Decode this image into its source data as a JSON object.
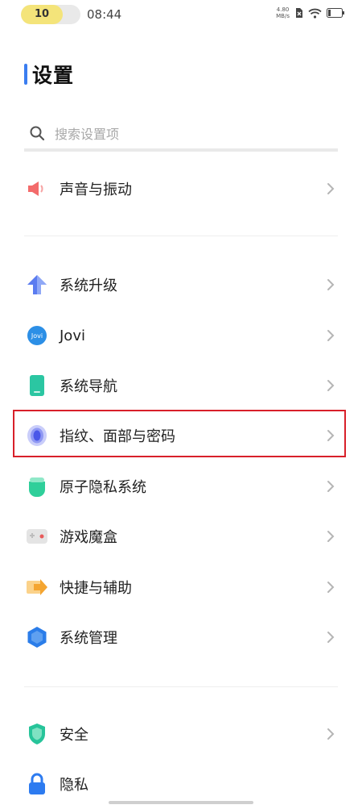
{
  "status_bar": {
    "battery": "10",
    "time": "08:44",
    "net_speed_value": "4.80",
    "net_speed_unit": "MB/s"
  },
  "page": {
    "title": "设置"
  },
  "search": {
    "placeholder": "搜索设置项"
  },
  "items": [
    {
      "label": "声音与振动",
      "icon": "speaker-icon",
      "color": "#f36b6b"
    },
    {
      "label": "系统升级",
      "icon": "upgrade-arrow-icon",
      "color": "#5b7cf0"
    },
    {
      "label": "Jovi",
      "icon": "jovi-icon",
      "color": "#2c8fe6"
    },
    {
      "label": "系统导航",
      "icon": "phone-navigation-icon",
      "color": "#2bc6a2"
    },
    {
      "label": "指纹、面部与密码",
      "icon": "fingerprint-icon",
      "color": "#5b6cf0"
    },
    {
      "label": "原子隐私系统",
      "icon": "atomic-privacy-icon",
      "color": "#2fcf9a"
    },
    {
      "label": "游戏魔盒",
      "icon": "game-box-icon",
      "color": "#e85a5a"
    },
    {
      "label": "快捷与辅助",
      "icon": "shortcut-arrow-icon",
      "color": "#f4a531"
    },
    {
      "label": "系统管理",
      "icon": "system-management-icon",
      "color": "#2b7de9"
    },
    {
      "label": "安全",
      "icon": "shield-icon",
      "color": "#27c49a"
    },
    {
      "label": "隐私",
      "icon": "lock-icon",
      "color": "#2d7bf0"
    }
  ],
  "colors": {
    "accent": "#3a7df0",
    "highlight_border": "#d8202a"
  }
}
